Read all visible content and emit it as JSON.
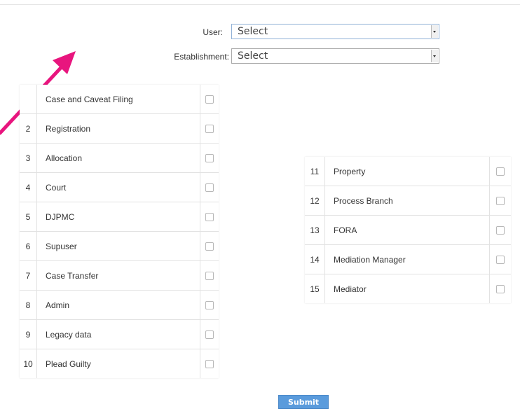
{
  "form": {
    "user_label": "User:",
    "user_value": "Select",
    "establishment_label": "Establishment:",
    "establishment_value": "Select"
  },
  "roles_left": [
    {
      "num": "",
      "name": "Case and Caveat Filing"
    },
    {
      "num": "2",
      "name": "Registration"
    },
    {
      "num": "3",
      "name": "Allocation"
    },
    {
      "num": "4",
      "name": "Court"
    },
    {
      "num": "5",
      "name": "DJPMC"
    },
    {
      "num": "6",
      "name": "Supuser"
    },
    {
      "num": "7",
      "name": "Case Transfer"
    },
    {
      "num": "8",
      "name": "Admin"
    },
    {
      "num": "9",
      "name": "Legacy data"
    },
    {
      "num": "10",
      "name": "Plead Guilty"
    }
  ],
  "roles_right": [
    {
      "num": "11",
      "name": "Property"
    },
    {
      "num": "12",
      "name": "Process Branch"
    },
    {
      "num": "13",
      "name": "FORA"
    },
    {
      "num": "14",
      "name": "Mediation Manager"
    },
    {
      "num": "15",
      "name": "Mediator"
    }
  ],
  "submit_label": "Submit",
  "colors": {
    "annotation_arrow": "#e8157e",
    "submit_bg": "#5a9bdc"
  }
}
